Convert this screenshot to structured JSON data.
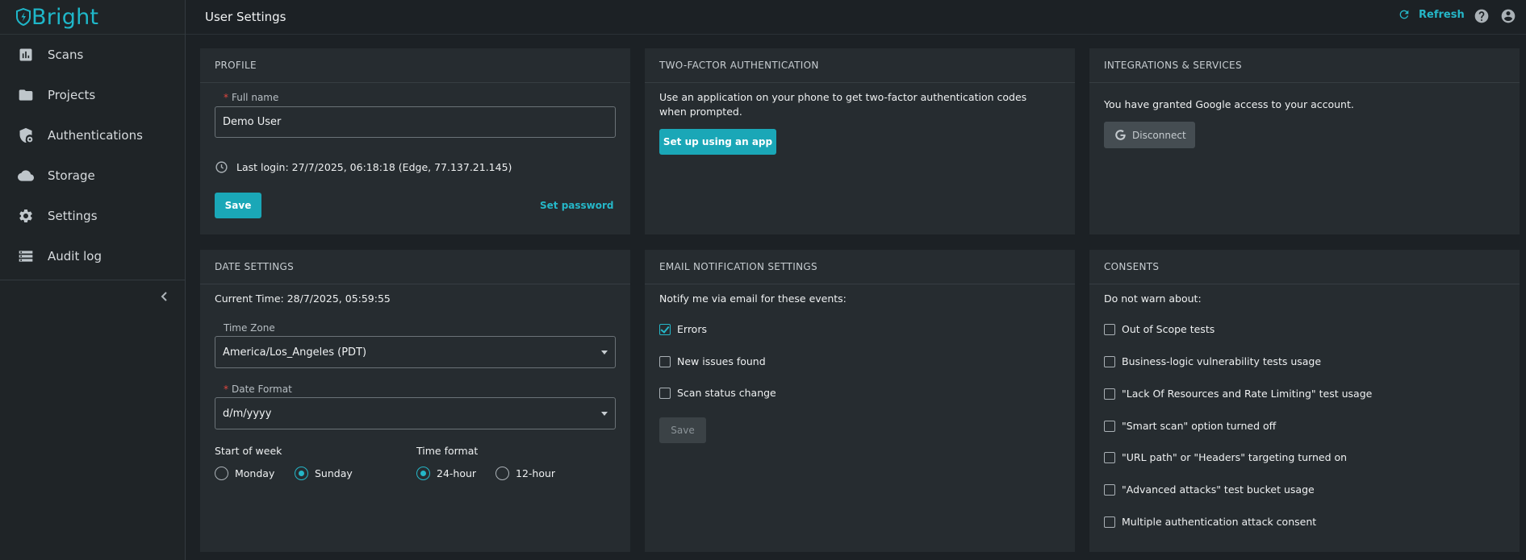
{
  "app": {
    "brand": "Bright"
  },
  "sidebar": {
    "items": [
      {
        "label": "Scans",
        "icon": "bar-chart-icon"
      },
      {
        "label": "Projects",
        "icon": "folder-icon"
      },
      {
        "label": "Authentications",
        "icon": "shield-lock-icon"
      },
      {
        "label": "Storage",
        "icon": "cloud-icon"
      },
      {
        "label": "Settings",
        "icon": "gear-icon"
      },
      {
        "label": "Audit log",
        "icon": "storage-list-icon"
      }
    ],
    "collapse_icon": "chevron-left-icon"
  },
  "header": {
    "title": "User Settings",
    "refresh_label": "Refresh",
    "help_icon": "help-circle-icon",
    "account_icon": "account-circle-icon"
  },
  "profile": {
    "title": "PROFILE",
    "full_name_label": "Full name",
    "full_name_value": "Demo User",
    "last_login": "Last login: 27/7/2025, 06:18:18 (Edge, 77.137.21.145)",
    "save_label": "Save",
    "set_password_label": "Set password"
  },
  "two_factor": {
    "title": "TWO-FACTOR AUTHENTICATION",
    "description": "Use an application on your phone to get two-factor authentication codes when prompted.",
    "setup_label": "Set up using an app"
  },
  "integrations": {
    "title": "INTEGRATIONS & SERVICES",
    "description": "You have granted Google access to your account.",
    "disconnect_label": "Disconnect"
  },
  "date_settings": {
    "title": "DATE SETTINGS",
    "current_time": "Current Time: 28/7/2025, 05:59:55",
    "time_zone_label": "Time Zone",
    "time_zone_value": "America/Los_Angeles (PDT)",
    "date_format_label": "Date Format",
    "date_format_value": "d/m/yyyy",
    "start_of_week_label": "Start of week",
    "week_options": [
      "Monday",
      "Sunday"
    ],
    "week_selected": "Sunday",
    "time_format_label": "Time format",
    "time_options": [
      "24-hour",
      "12-hour"
    ],
    "time_selected": "24-hour"
  },
  "email": {
    "title": "EMAIL NOTIFICATION SETTINGS",
    "intro": "Notify me via email for these events:",
    "options": [
      {
        "label": "Errors",
        "checked": true
      },
      {
        "label": "New issues found",
        "checked": false
      },
      {
        "label": "Scan status change",
        "checked": false
      }
    ],
    "save_label": "Save"
  },
  "consents": {
    "title": "CONSENTS",
    "intro": "Do not warn about:",
    "options": [
      {
        "label": "Out of Scope tests",
        "checked": false
      },
      {
        "label": "Business-logic vulnerability tests usage",
        "checked": false
      },
      {
        "label": "\"Lack Of Resources and Rate Limiting\" test usage",
        "checked": false
      },
      {
        "label": "\"Smart scan\" option turned off",
        "checked": false
      },
      {
        "label": "\"URL path\" or \"Headers\" targeting turned on",
        "checked": false
      },
      {
        "label": "\"Advanced attacks\" test bucket usage",
        "checked": false
      },
      {
        "label": "Multiple authentication attack consent",
        "checked": false
      }
    ]
  },
  "colors": {
    "accent": "#1aa7b7",
    "background": "#1c2125",
    "card": "#262c30",
    "required": "#e0473f"
  }
}
